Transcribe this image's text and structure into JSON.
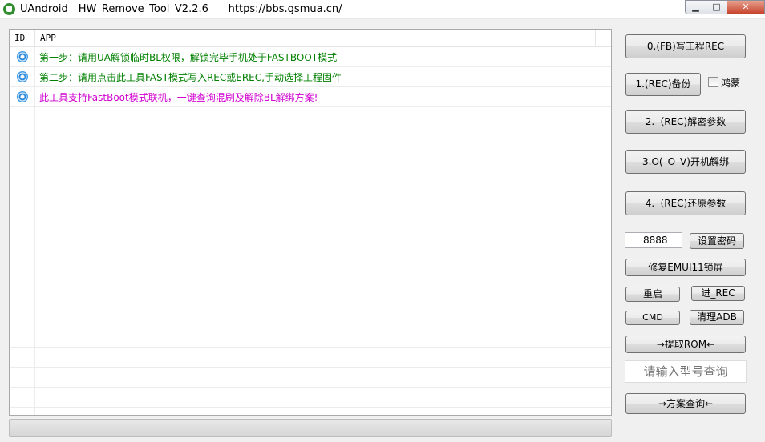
{
  "window": {
    "title": "UAndroid__HW_Remove_Tool_V2.2.6      https://bbs.gsmua.cn/"
  },
  "list": {
    "columns": [
      "ID",
      "APP"
    ],
    "rows": [
      {
        "text": "第一步：请用UA解锁临时BL权限，解锁完毕手机处于FASTBOOT模式",
        "color": "#008000"
      },
      {
        "text": "第二步：请用点击此工具FAST模式写入REC或EREC,手动选择工程固件",
        "color": "#008000"
      },
      {
        "text": "此工具支持FastBoot模式联机，一键查询混刷及解除BL解绑方案!",
        "color": "#d000d0"
      }
    ]
  },
  "buttons": {
    "fb_write_rec": "0.(FB)写工程REC",
    "rec_backup": "1.(REC)备份",
    "rec_decrypt": "2.（REC)解密参数",
    "o_v_unlock": "3.O(_O_V)开机解绑",
    "rec_restore": "4.（REC)还原参数",
    "set_password": "设置密码",
    "fix_emui": "修复EMUI11锁屏",
    "reboot": "重启",
    "enter_rec": "进_REC",
    "cmd": "CMD",
    "clean_adb": "清理ADB",
    "extract_rom": "→提取ROM←",
    "query_solution": "→方案查询←"
  },
  "checkbox": {
    "harmony_label": "鸿蒙",
    "checked": false
  },
  "inputs": {
    "password_value": "8888",
    "model_placeholder": "请输入型号查询"
  },
  "icons": {
    "app": "app-logo-icon",
    "row": "info-circle-icon"
  }
}
